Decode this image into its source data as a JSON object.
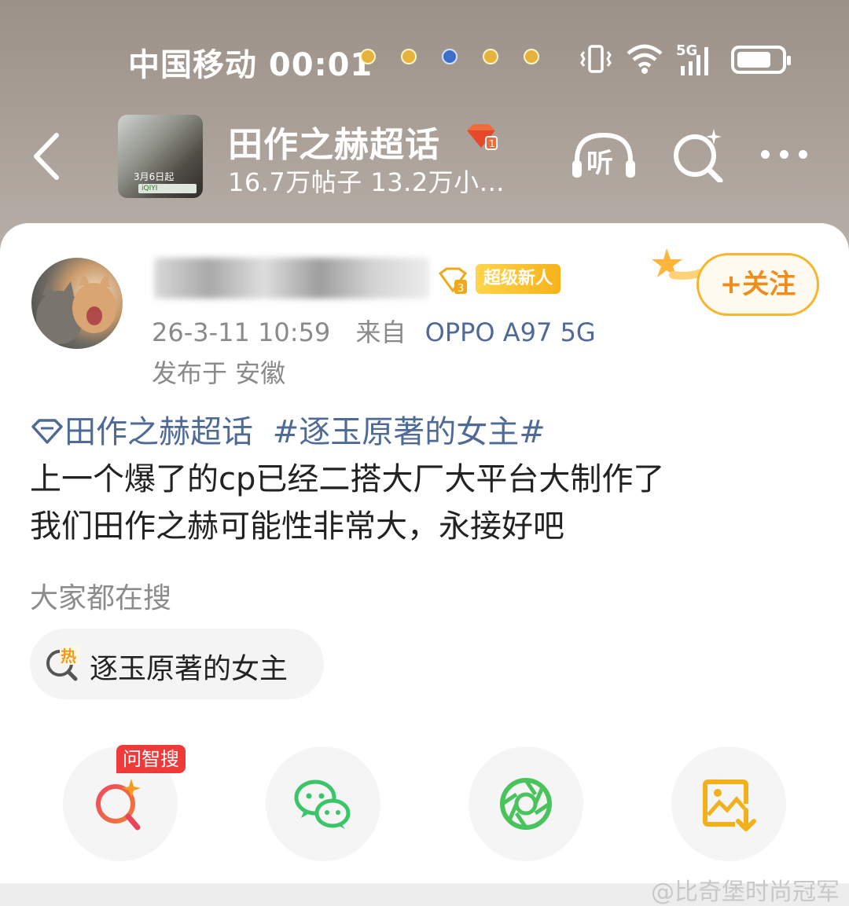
{
  "status_bar": {
    "carrier_time": "中国移动 00:01",
    "network": "5G"
  },
  "nav": {
    "cover_date_text": "3月6日起",
    "cover_platform_text": "iQIYI",
    "topic_title": "田作之赫超话",
    "topic_stats": "16.7万帖子 13.2万小…",
    "listen_label": "听"
  },
  "post": {
    "badge_label": "超级新人",
    "follow_label": "+关注",
    "timestamp": "26-3-11 10:59",
    "source_prefix": "来自",
    "device": "OPPO A97 5G",
    "location": "发布于 安徽",
    "topic_link": "田作之赫超话",
    "hashtag": "#逐玉原著的女主#",
    "line1": "上一个爆了的cp已经二搭大厂大平台大制作了",
    "line2": "我们田作之赫可能性非常大，永接好吧"
  },
  "search": {
    "heading": "大家都在搜",
    "hot_badge": "热",
    "chip_label": "逐玉原著的女主"
  },
  "share": {
    "ai_tag": "问智搜"
  },
  "watermark": "@比奇堡时尚冠军"
}
